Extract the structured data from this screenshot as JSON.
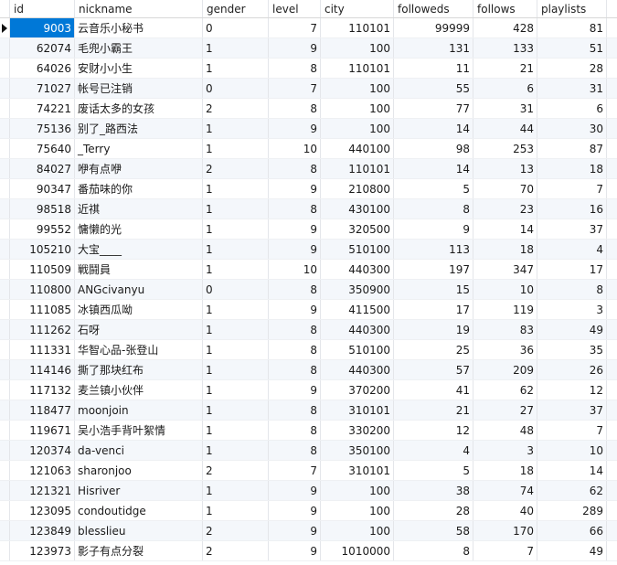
{
  "columns": [
    "id",
    "nickname",
    "gender",
    "level",
    "city",
    "followeds",
    "follows",
    "playlists"
  ],
  "rows": [
    {
      "id": "9003",
      "nickname": "云音乐小秘书",
      "gender": "0",
      "level": "7",
      "city": "110101",
      "followeds": "99999",
      "follows": "428",
      "playlists": "81"
    },
    {
      "id": "62074",
      "nickname": "毛兜小霸王",
      "gender": "1",
      "level": "9",
      "city": "100",
      "followeds": "131",
      "follows": "133",
      "playlists": "51"
    },
    {
      "id": "64026",
      "nickname": "安财小小生",
      "gender": "1",
      "level": "8",
      "city": "110101",
      "followeds": "11",
      "follows": "21",
      "playlists": "28"
    },
    {
      "id": "71027",
      "nickname": "帐号已注销",
      "gender": "0",
      "level": "7",
      "city": "100",
      "followeds": "55",
      "follows": "6",
      "playlists": "31"
    },
    {
      "id": "74221",
      "nickname": "废话太多的女孩",
      "gender": "2",
      "level": "8",
      "city": "100",
      "followeds": "77",
      "follows": "31",
      "playlists": "6"
    },
    {
      "id": "75136",
      "nickname": "别了_路西法",
      "gender": "1",
      "level": "9",
      "city": "100",
      "followeds": "14",
      "follows": "44",
      "playlists": "30"
    },
    {
      "id": "75640",
      "nickname": "_Terry",
      "gender": "1",
      "level": "10",
      "city": "440100",
      "followeds": "98",
      "follows": "253",
      "playlists": "87"
    },
    {
      "id": "84027",
      "nickname": "咿有点咿",
      "gender": "2",
      "level": "8",
      "city": "110101",
      "followeds": "14",
      "follows": "13",
      "playlists": "18"
    },
    {
      "id": "90347",
      "nickname": "番茄味的你",
      "gender": "1",
      "level": "9",
      "city": "210800",
      "followeds": "5",
      "follows": "70",
      "playlists": "7"
    },
    {
      "id": "98518",
      "nickname": "近祺",
      "gender": "1",
      "level": "8",
      "city": "430100",
      "followeds": "8",
      "follows": "23",
      "playlists": "16"
    },
    {
      "id": "99552",
      "nickname": "慵懒的光",
      "gender": "1",
      "level": "9",
      "city": "320500",
      "followeds": "9",
      "follows": "14",
      "playlists": "37"
    },
    {
      "id": "105210",
      "nickname": "大宝____",
      "gender": "1",
      "level": "9",
      "city": "510100",
      "followeds": "113",
      "follows": "18",
      "playlists": "4"
    },
    {
      "id": "110509",
      "nickname": "戦鬪員",
      "gender": "1",
      "level": "10",
      "city": "440300",
      "followeds": "197",
      "follows": "347",
      "playlists": "17"
    },
    {
      "id": "110800",
      "nickname": "ANGcivanyu",
      "gender": "0",
      "level": "8",
      "city": "350900",
      "followeds": "15",
      "follows": "10",
      "playlists": "8"
    },
    {
      "id": "111085",
      "nickname": "冰镇西瓜呦",
      "gender": "1",
      "level": "9",
      "city": "411500",
      "followeds": "17",
      "follows": "119",
      "playlists": "3"
    },
    {
      "id": "111262",
      "nickname": "石呀",
      "gender": "1",
      "level": "8",
      "city": "440300",
      "followeds": "19",
      "follows": "83",
      "playlists": "49"
    },
    {
      "id": "111331",
      "nickname": "华智心品-张登山",
      "gender": "1",
      "level": "8",
      "city": "510100",
      "followeds": "25",
      "follows": "36",
      "playlists": "35"
    },
    {
      "id": "114146",
      "nickname": "撕了那块红布",
      "gender": "1",
      "level": "8",
      "city": "440300",
      "followeds": "57",
      "follows": "209",
      "playlists": "26"
    },
    {
      "id": "117132",
      "nickname": "麦兰镇小伙伴",
      "gender": "1",
      "level": "9",
      "city": "370200",
      "followeds": "41",
      "follows": "62",
      "playlists": "12"
    },
    {
      "id": "118477",
      "nickname": "moonjoin",
      "gender": "1",
      "level": "8",
      "city": "310101",
      "followeds": "21",
      "follows": "27",
      "playlists": "37"
    },
    {
      "id": "119671",
      "nickname": "吴小浩手背叶絮情",
      "gender": "1",
      "level": "8",
      "city": "330200",
      "followeds": "12",
      "follows": "48",
      "playlists": "7"
    },
    {
      "id": "120374",
      "nickname": "da-venci",
      "gender": "1",
      "level": "8",
      "city": "350100",
      "followeds": "4",
      "follows": "3",
      "playlists": "10"
    },
    {
      "id": "121063",
      "nickname": "sharonjoo",
      "gender": "2",
      "level": "7",
      "city": "310101",
      "followeds": "5",
      "follows": "18",
      "playlists": "14"
    },
    {
      "id": "121321",
      "nickname": "Hisriver",
      "gender": "1",
      "level": "9",
      "city": "100",
      "followeds": "38",
      "follows": "74",
      "playlists": "62"
    },
    {
      "id": "123095",
      "nickname": "condoutidge",
      "gender": "1",
      "level": "9",
      "city": "100",
      "followeds": "28",
      "follows": "40",
      "playlists": "289"
    },
    {
      "id": "123849",
      "nickname": "blesslieu",
      "gender": "2",
      "level": "9",
      "city": "100",
      "followeds": "58",
      "follows": "170",
      "playlists": "66"
    },
    {
      "id": "123973",
      "nickname": "影子有点分裂",
      "gender": "2",
      "level": "9",
      "city": "1010000",
      "followeds": "8",
      "follows": "7",
      "playlists": "49"
    }
  ],
  "selection": {
    "row_index": 0,
    "column": "id",
    "selected_color": "#0078d7",
    "alt_row_color": "#f4f7fb"
  }
}
